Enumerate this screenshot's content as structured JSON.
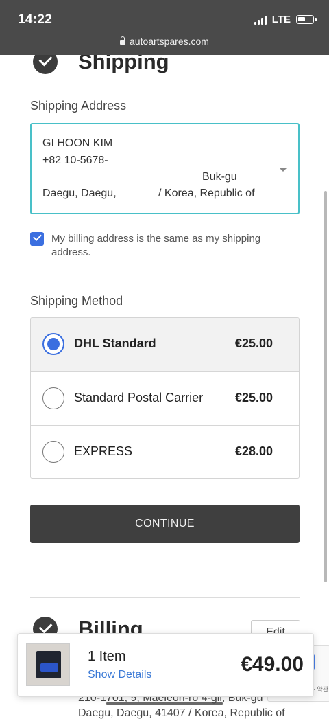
{
  "status": {
    "time": "14:22",
    "network": "LTE",
    "url": "autoartspares.com"
  },
  "shipping": {
    "title": "Shipping",
    "address_label": "Shipping Address",
    "address": {
      "name": "GI HOON KIM",
      "phone": "+82 10-5678-",
      "district": "Buk-gu",
      "city": "Daegu, Daegu,",
      "country": "/ Korea, Republic of"
    },
    "billing_same_label": "My billing address is the same as my shipping address.",
    "billing_same_checked": true,
    "method_label": "Shipping Method",
    "methods": [
      {
        "name": "DHL Standard",
        "price": "€25.00",
        "selected": true
      },
      {
        "name": "Standard Postal Carrier",
        "price": "€25.00",
        "selected": false
      },
      {
        "name": "EXPRESS",
        "price": "€28.00",
        "selected": false
      }
    ],
    "continue_label": "CONTINUE"
  },
  "billing": {
    "title": "Billing",
    "edit_label": "Edit",
    "address_lines": [
      "210-1701, 9, Maeleon-ro 4-gil, Buk-gu",
      "Daegu, Daegu, 41407 / Korea, Republic of"
    ]
  },
  "cart": {
    "count": "1 Item",
    "details_link": "Show Details",
    "total": "€49.00"
  },
  "recaptcha": {
    "text": "- 약관"
  },
  "colors": {
    "accent": "#3b6fe0",
    "focus_border": "#49c0c8",
    "button_bg": "#3f3f3f",
    "link": "#3a79d6"
  }
}
